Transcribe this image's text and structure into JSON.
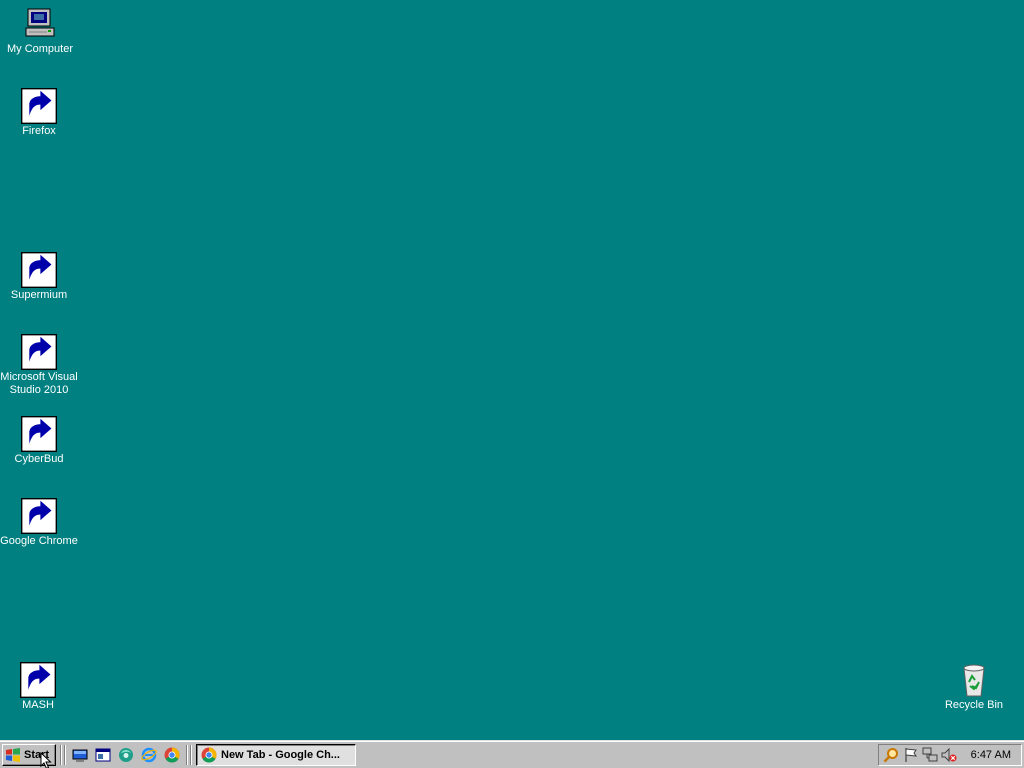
{
  "desktop": {
    "background_color": "#008080",
    "icons": [
      {
        "label": "My Computer",
        "icon": "my-computer-icon"
      },
      {
        "label": "Firefox",
        "icon": "firefox-icon"
      },
      {
        "label": "Supermium",
        "icon": "supermium-icon"
      },
      {
        "label": "Microsoft Visual Studio 2010",
        "icon": "visual-studio-icon"
      },
      {
        "label": "CyberBud",
        "icon": "cyberbud-icon"
      },
      {
        "label": "Google Chrome",
        "icon": "chrome-icon"
      },
      {
        "label": "MASH",
        "icon": "mash-icon"
      },
      {
        "label": "Recycle Bin",
        "icon": "recycle-bin-icon"
      }
    ]
  },
  "taskbar": {
    "start_label": "Start",
    "quick_launch": [
      "show-desktop-icon",
      "explorer-icon",
      "supermium-icon",
      "internet-explorer-icon",
      "chrome-icon"
    ],
    "active_task": {
      "label": "New Tab - Google Ch...",
      "icon": "chrome-icon"
    },
    "tray_icons": [
      "search-icon",
      "flag-icon",
      "network-icon",
      "volume-muted-icon"
    ],
    "clock": "6:47 AM"
  }
}
